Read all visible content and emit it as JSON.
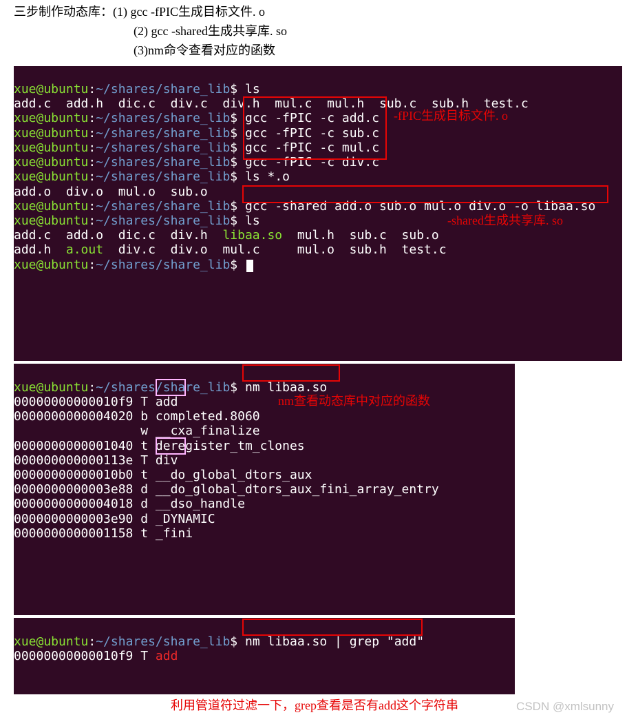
{
  "doc": {
    "line1_prefix": "三步制作动态库：",
    "step1": "(1) gcc -fPIC生成目标文件. o",
    "step2": "(2) gcc -shared生成共享库. so",
    "step3": "(3)nm命令查看对应的函数"
  },
  "prompt": {
    "user": "xue@ubuntu",
    "colon": ":",
    "path": "~/shares/share_lib",
    "dollar": "$ "
  },
  "t1": {
    "c_ls": "ls",
    "ls_files": "add.c  add.h  dic.c  div.c  div.h  mul.c  mul.h  sub.c  sub.h  test.c",
    "g1": "gcc -fPIC -c add.c",
    "g2": "gcc -fPIC -c sub.c",
    "g3": "gcc -fPIC -c mul.c",
    "g4": "gcc -fPIC -c div.c",
    "c_lso": "ls *.o",
    "lso_out": "add.o  div.o  mul.o  sub.o",
    "gs": "gcc -shared add.o sub.o mul.o div.o -o libaa.so",
    "c_ls2": "ls",
    "ls2_row1_a": "add.c  add.o  dic.c  div.h  ",
    "ls2_row1_lib": "libaa.so",
    "ls2_row1_b": "  mul.h  sub.c  sub.o",
    "ls2_row2_a": "add.h  ",
    "ls2_row2_aout": "a.out",
    "ls2_row2_b": "  div.c  div.o  mul.c     mul.o  sub.h  test.c"
  },
  "t2": {
    "cmd": "nm libaa.so",
    "l1_addr": "00000000000010f9 T ",
    "l1_sym": "add",
    "l2": "0000000000004020 b completed.8060",
    "l3": "                 w __cxa_finalize",
    "l4": "0000000000001040 t deregister_tm_clones",
    "l5_addr": "000000000000113e T ",
    "l5_sym": "div",
    "l6": "00000000000010b0 t __do_global_dtors_aux",
    "l7": "0000000000003e88 d __do_global_dtors_aux_fini_array_entry",
    "l8": "0000000000004018 d __dso_handle",
    "l9": "0000000000003e90 d _DYNAMIC",
    "l10": "0000000000001158 t _fini"
  },
  "t3": {
    "cmd": "nm libaa.so | grep \"add\"",
    "out_addrT": "00000000000010f9 T ",
    "out_sym": "add"
  },
  "anno": {
    "a1": "-fPIC生成目标文件. o",
    "a2": "-shared生成共享库. so",
    "a3": "nm查看动态库中对应的函数",
    "a4": "利用管道符过滤一下，grep查看是否有add这个字符串"
  },
  "watermark": "CSDN @xmlsunny"
}
